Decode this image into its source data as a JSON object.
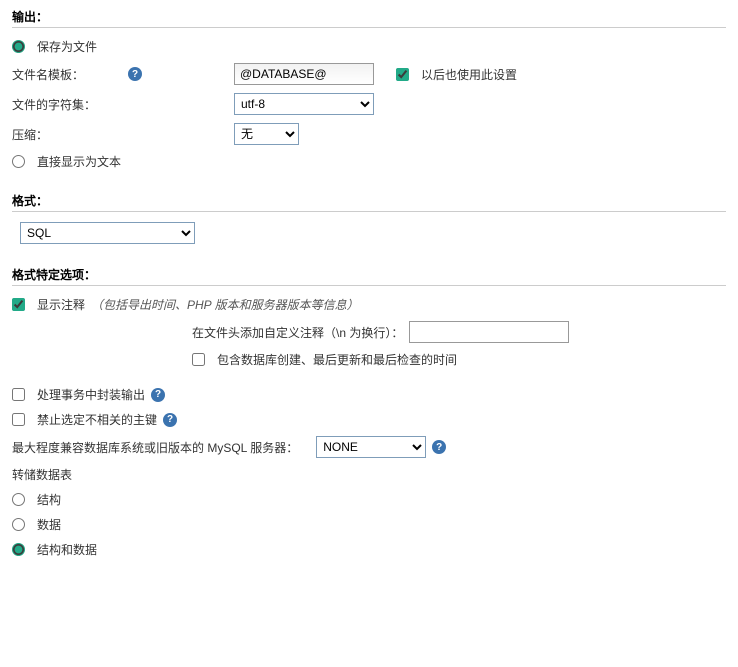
{
  "output": {
    "title": "输出：",
    "saveAsFile": "保存为文件",
    "filenameTemplate": "文件名模板：",
    "filenameValue": "@DATABASE@",
    "useFutureLabel": "以后也使用此设置",
    "charset": "文件的字符集：",
    "charsetValue": "utf-8",
    "compression": "压缩：",
    "compressionValue": "无",
    "displayAsText": "直接显示为文本"
  },
  "format": {
    "title": "格式：",
    "value": "SQL"
  },
  "options": {
    "title": "格式特定选项：",
    "showComments": "显示注释",
    "showCommentsNote": "（包括导出时间、PHP 版本和服务器版本等信息）",
    "customCommentLabel": "在文件头添加自定义注释（\\n 为换行）：",
    "customCommentValue": "",
    "includeDbTimes": "包含数据库创建、最后更新和最后检查的时间",
    "transactionWrap": "处理事务中封装输出",
    "disableFK": "禁止选定不相关的主键",
    "compatLabel": "最大程度兼容数据库系统或旧版本的 MySQL 服务器：",
    "compatValue": "NONE",
    "dumpTables": "转储数据表",
    "dumpStructure": "结构",
    "dumpData": "数据",
    "dumpBoth": "结构和数据"
  }
}
